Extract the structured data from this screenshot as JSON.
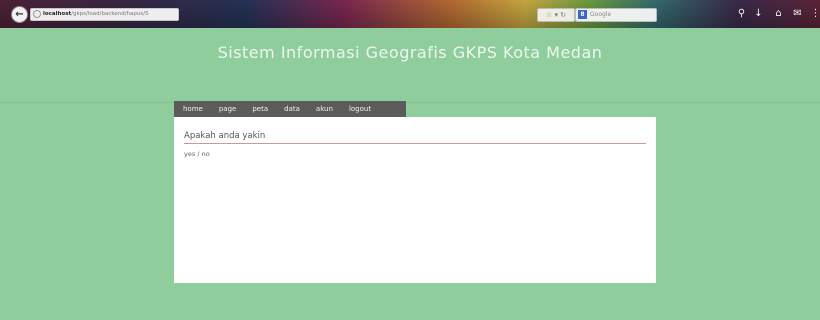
{
  "browser": {
    "url_host": "localhost",
    "url_path": "/gkps/load/backend/hapus/5",
    "search_placeholder": "Google",
    "search_engine": "8"
  },
  "site": {
    "title": "Sistem Informasi Geografis GKPS Kota Medan"
  },
  "nav": {
    "items": [
      "home",
      "page",
      "peta",
      "data",
      "akun",
      "logout"
    ]
  },
  "panel": {
    "heading": "Apakah anda yakin",
    "yes_label": "yes",
    "separator": "/",
    "no_label": "no"
  },
  "colors": {
    "page_bg": "#8fcd9c",
    "nav_bg": "#5c5c5c",
    "panel_bg": "#ffffff",
    "rule": "#cc9999"
  }
}
